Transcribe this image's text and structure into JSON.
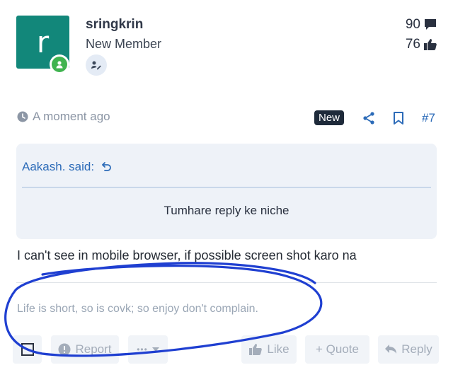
{
  "user": {
    "avatar_letter": "r",
    "username": "sringkrin",
    "title": "New Member",
    "message_count": "90",
    "reaction_count": "76",
    "avatar_color": "#12877a",
    "online_color": "#3fb34f"
  },
  "post": {
    "time": "A moment ago",
    "new_badge": "New",
    "post_number": "#7",
    "quote_author": "Aakash. said:",
    "quote_text": "Tumhare reply ke niche",
    "message": "I can't see in mobile browser, if possible screen shot karo na",
    "signature": "Life is short, so is covk; so enjoy don't complain."
  },
  "actions": {
    "report": "Report",
    "more": "•••",
    "like": "Like",
    "quote": "+ Quote",
    "reply": "Reply"
  },
  "colors": {
    "accent": "#2c6bb8",
    "annotation": "#1f3fd1"
  }
}
